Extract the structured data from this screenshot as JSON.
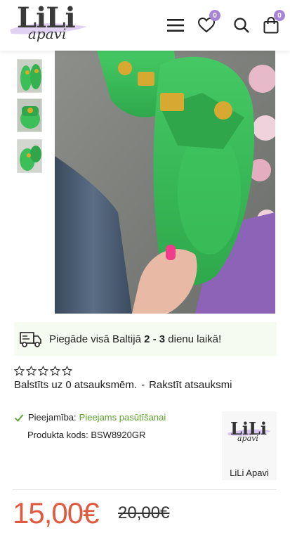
{
  "header": {
    "logo_main": "LiLi",
    "logo_sub": "apavi",
    "wishlist_count": "0",
    "cart_count": "0",
    "icons": [
      "menu-icon",
      "heart-icon",
      "search-icon",
      "cart-icon"
    ],
    "accent_color": "#a884d6"
  },
  "gallery": {
    "thumbnail_count": 3
  },
  "shipping": {
    "text_before": "Piegāde visā Baltijā ",
    "text_bold": "2 - 3",
    "text_after": " dienu laikā!"
  },
  "rating": {
    "stars_filled": 0,
    "stars_total": 5,
    "based_on_text": "Balstīts uz 0 atsauksmēm.",
    "separator": "-",
    "write_review_link": "Rakstīt atsauksmi"
  },
  "product": {
    "availability_label": "Pieejamība:",
    "availability_value": "Pieejams pasūtīšanai",
    "code_label": "Produkta kods:",
    "code_value": "BSW8920GR",
    "brand_name": "LiLi Apavi",
    "brand_logo_main": "LiLi",
    "brand_logo_sub": "apavi"
  },
  "price": {
    "current": "15,00€",
    "old": "20,00€",
    "current_color": "#e05a40"
  }
}
